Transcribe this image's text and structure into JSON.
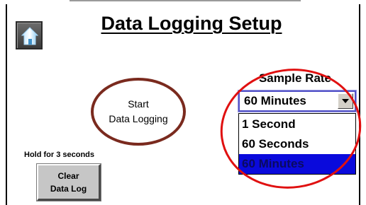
{
  "header": {
    "title": "Data Logging Setup",
    "home_icon": "home-icon"
  },
  "start_logging": {
    "line1": "Start",
    "line2": "Data Logging"
  },
  "clear_log": {
    "hint": "Hold for 3 seconds",
    "line1": "Clear",
    "line2": "Data Log"
  },
  "sample_rate": {
    "label": "Sample Rate",
    "selected": "60 Minutes",
    "options": [
      "1 Second",
      "60 Seconds",
      "60 Minutes"
    ],
    "selected_index": 2
  },
  "colors": {
    "start_ring": "#7a2a1e",
    "annotation": "#e01010",
    "selection_highlight": "#0a0adc"
  }
}
